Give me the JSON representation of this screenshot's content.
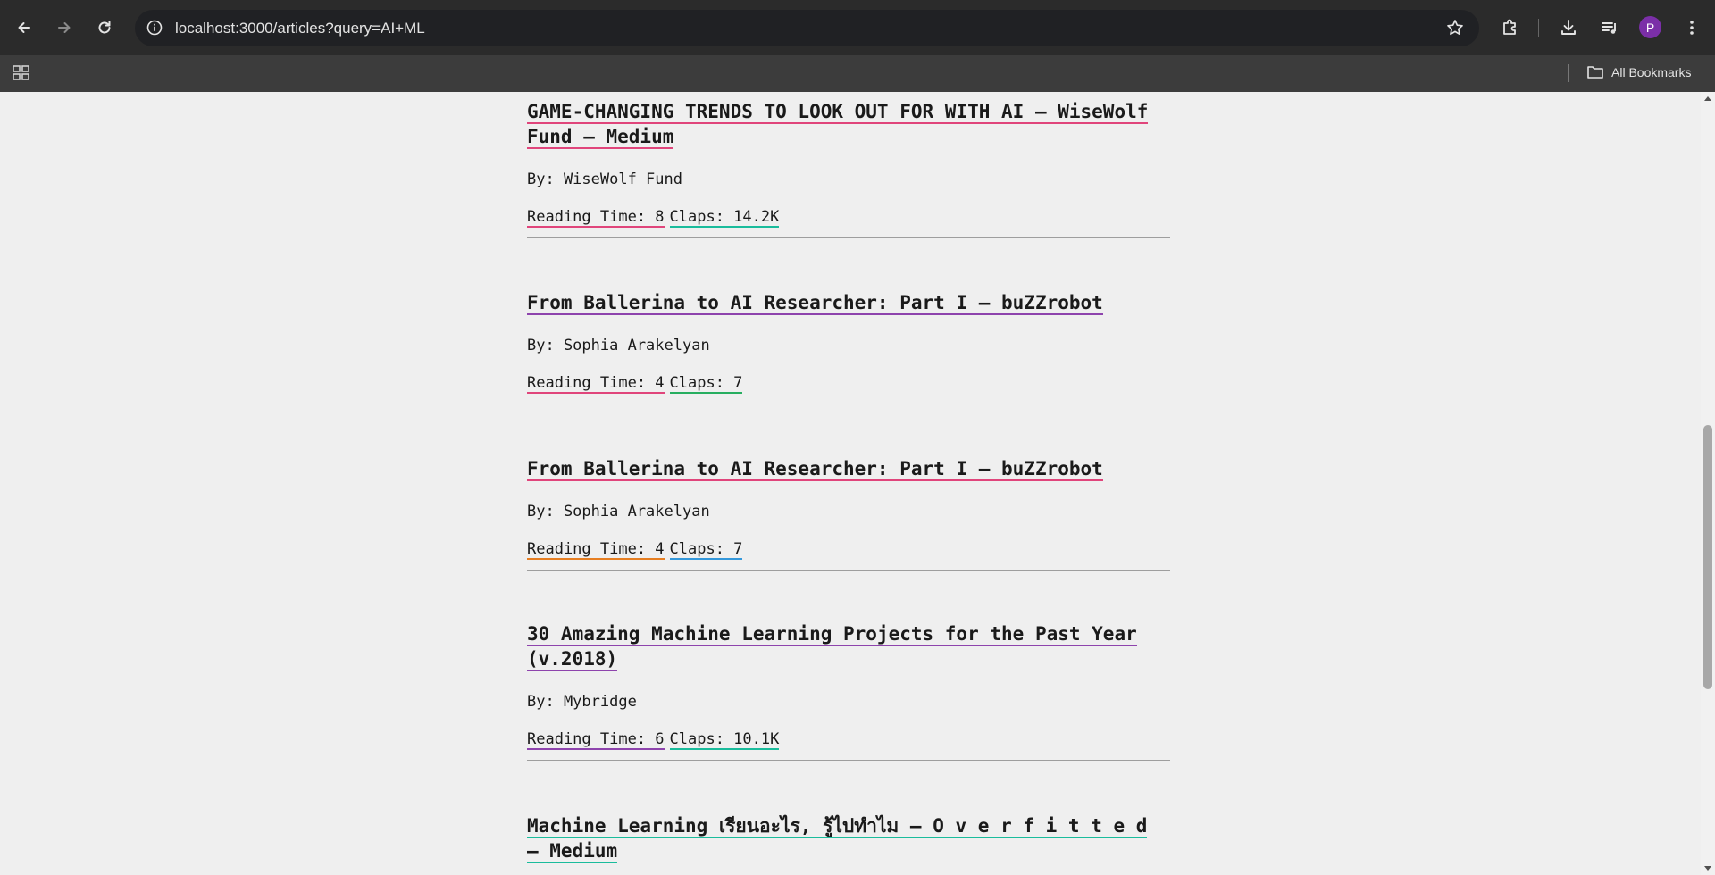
{
  "browser": {
    "url": "localhost:3000/articles?query=AI+ML",
    "avatar_letter": "P",
    "bookmarks_label": "All Bookmarks"
  },
  "articles": [
    {
      "title": "GAME-CHANGING TRENDS TO LOOK OUT FOR WITH AI — WiseWolf Fund — Medium",
      "author": "By: WiseWolf Fund",
      "reading_time": "Reading Time: 8",
      "claps": "Claps: 14.2K",
      "title_color": "#e0457b",
      "reading_color": "#e0457b",
      "claps_color": "#1abc9c"
    },
    {
      "title": "From Ballerina to AI Researcher: Part I – buZZrobot",
      "author": "By: Sophia Arakelyan",
      "reading_time": "Reading Time: 4",
      "claps": "Claps: 7",
      "title_color": "#8e44ad",
      "reading_color": "#e0457b",
      "claps_color": "#27ae60"
    },
    {
      "title": "From Ballerina to AI Researcher: Part I – buZZrobot",
      "author": "By: Sophia Arakelyan",
      "reading_time": "Reading Time: 4",
      "claps": "Claps: 7",
      "title_color": "#e0457b",
      "reading_color": "#e67e22",
      "claps_color": "#3498db"
    },
    {
      "title": "30 Amazing Machine Learning Projects for the Past Year (v.2018)",
      "author": "By: Mybridge",
      "reading_time": "Reading Time: 6",
      "claps": "Claps: 10.1K",
      "title_color": "#8e44ad",
      "reading_color": "#8e44ad",
      "claps_color": "#1abc9c"
    },
    {
      "title": "Machine Learning เรียนอะไร, รู้ไปทำไม – O v e r f i t t e d – Medium",
      "title_color": "#1abc9c"
    }
  ]
}
